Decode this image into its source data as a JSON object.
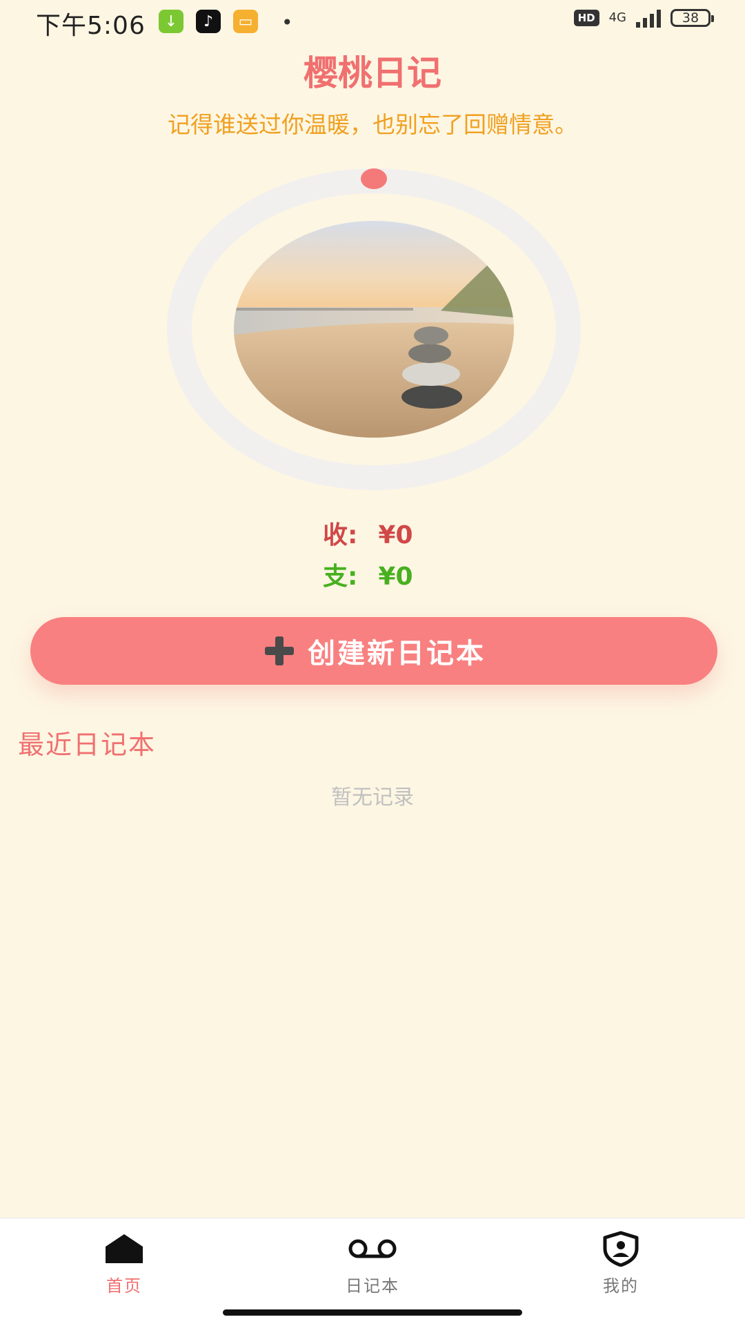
{
  "status_bar": {
    "time": "下午5:06",
    "hd_badge": "HD",
    "network": "4G",
    "battery": "38"
  },
  "header": {
    "title": "樱桃日记",
    "subtitle": "记得谁送过你温暖，也别忘了回赠情意。"
  },
  "summary": {
    "income_label": "收:",
    "income_value": "¥0",
    "expense_label": "支:",
    "expense_value": "¥0"
  },
  "create_button": {
    "label": "创建新日记本",
    "icon": "plus-icon"
  },
  "recent": {
    "title": "最近日记本",
    "empty_text": "暂无记录"
  },
  "tabs": [
    {
      "label": "首页",
      "icon": "home-icon",
      "active": true
    },
    {
      "label": "日记本",
      "icon": "voicemail-icon",
      "active": false
    },
    {
      "label": "我的",
      "icon": "profile-shield-icon",
      "active": false
    }
  ],
  "colors": {
    "background": "#fdf6e3",
    "accent": "#f98080",
    "title": "#f07070",
    "subtitle": "#f0a020",
    "income": "#d04848",
    "expense": "#48b020"
  }
}
